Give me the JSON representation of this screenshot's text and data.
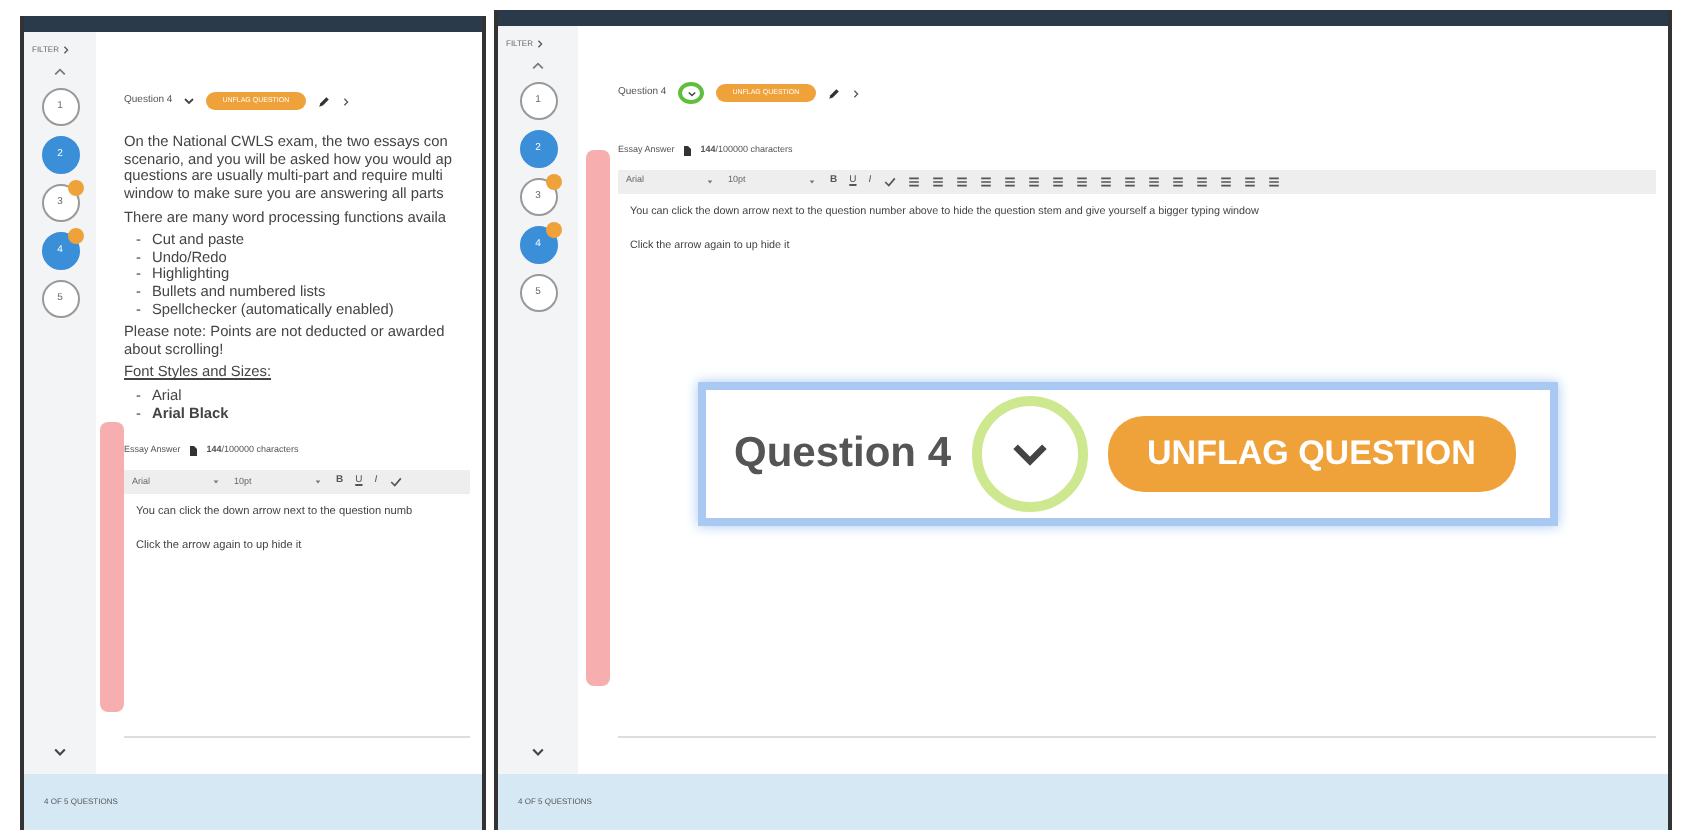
{
  "left_screen": {
    "filter": "FILTER",
    "questions": [
      {
        "label": "1",
        "answered": false,
        "flagged": false
      },
      {
        "label": "2",
        "answered": true,
        "flagged": false
      },
      {
        "label": "3",
        "answered": false,
        "flagged": true
      },
      {
        "label": "4",
        "answered": true,
        "flagged": true
      },
      {
        "label": "5",
        "answered": false,
        "flagged": false
      }
    ],
    "question_title": "Question 4",
    "flag_button": "UNFLAG QUESTION",
    "stem": [
      {
        "kind": "paragraph",
        "lines": [
          "On the National CWLS exam, the two essays con",
          "scenario, and you will be asked how you would ap",
          "questions are usually multi-part and require multi",
          "window to make sure you are answering all parts"
        ]
      },
      {
        "kind": "paragraph",
        "lines": [
          "There are many word processing functions availa"
        ]
      },
      {
        "kind": "list",
        "marker": "-",
        "items": [
          {
            "text": "Cut and paste",
            "bold": false
          },
          {
            "text": "Undo/Redo",
            "bold": false
          },
          {
            "text": "Highlighting",
            "bold": false
          },
          {
            "text": "Bullets and numbered lists",
            "bold": false
          },
          {
            "text": "Spellchecker (automatically enabled)",
            "bold": false
          }
        ]
      },
      {
        "kind": "paragraph",
        "lines": [
          "Please note: Points are not deducted or awarded",
          "about scrolling!"
        ]
      },
      {
        "kind": "heading",
        "lines": [
          "Font Styles and Sizes:"
        ]
      },
      {
        "kind": "list",
        "marker": "-",
        "items": [
          {
            "text": "Arial",
            "bold": false
          },
          {
            "text": "Arial Black",
            "bold": true
          }
        ]
      }
    ],
    "essay_label": "Essay Answer",
    "char_count": "144",
    "char_limit": "/100000 characters",
    "toolbar": {
      "font": "Arial",
      "size": "10pt",
      "buttons": [
        "B",
        "U",
        "I"
      ]
    },
    "answer_lines": [
      "You can click the down arrow next to the question numb",
      "Click the arrow again to up hide it"
    ],
    "footer": "4 OF 5 QUESTIONS"
  },
  "right_screen": {
    "filter": "FILTER",
    "questions": [
      {
        "label": "1",
        "answered": false,
        "flagged": false
      },
      {
        "label": "2",
        "answered": true,
        "flagged": false
      },
      {
        "label": "3",
        "answered": false,
        "flagged": true
      },
      {
        "label": "4",
        "answered": true,
        "flagged": true
      },
      {
        "label": "5",
        "answered": false,
        "flagged": false
      }
    ],
    "question_title": "Question 4",
    "flag_button": "UNFLAG QUESTION",
    "essay_label": "Essay Answer",
    "char_count": "144",
    "char_limit": "/100000 characters",
    "toolbar": {
      "font": "Arial",
      "size": "10pt",
      "buttons": [
        "B",
        "U",
        "I"
      ]
    },
    "answer_lines": [
      "You can click the down arrow next to the question number above to hide the question stem and give yourself a bigger typing window",
      "Click the arrow again to up hide it"
    ],
    "footer": "4 OF 5 QUESTIONS"
  },
  "callout": {
    "question_title": "Question 4",
    "flag_button": "UNFLAG QUESTION"
  }
}
